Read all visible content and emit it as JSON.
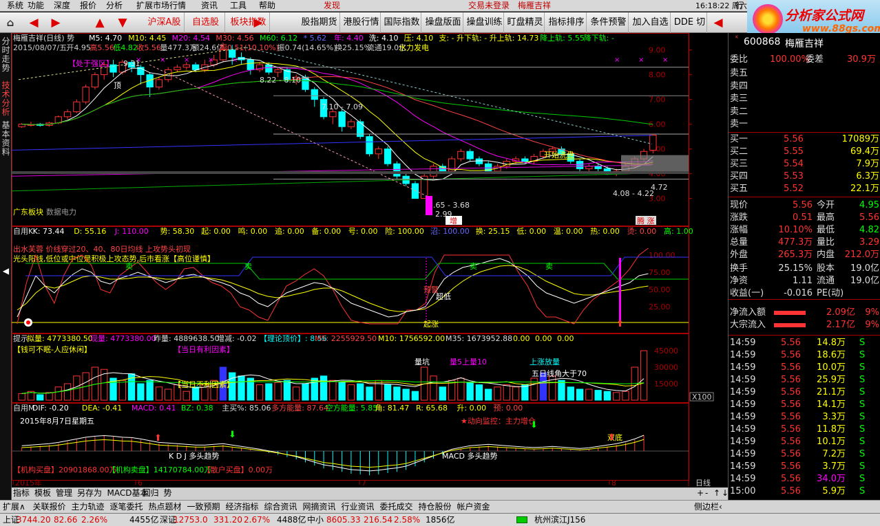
{
  "menu": {
    "items": [
      "系统",
      "功能",
      "深度",
      "报价",
      "分析",
      "扩展市场行情",
      "资讯",
      "工具",
      "帮助"
    ],
    "caption": "发现",
    "login": "交易未登录",
    "stock_title": "梅雁吉祥",
    "clock": "16:18:22 周六",
    "extra": "行"
  },
  "logo": {
    "name": "分析家公式网",
    "url": "www.88gs.com"
  },
  "toolbar": {
    "buttons": [
      "沪深A股",
      "自选股",
      "板块指数",
      "股指期货",
      "港股行情",
      "国际指数",
      "操盘版面",
      "操盘训练",
      "盯盘精灵",
      "指标排序",
      "条件预警",
      "加入自选",
      "DDE 切"
    ],
    "arrows": [
      "◀",
      "▶",
      "▲",
      "▼",
      "▶",
      "◀"
    ]
  },
  "leftbar": {
    "tabs": [
      "分时走势",
      "技术分析",
      "基本资料"
    ]
  },
  "main": {
    "title": "梅雁吉祥(日线) 势",
    "ma": [
      "M5: 4.70",
      "M10: 4.45",
      "M20: 4.54",
      "M30: 4.56",
      "M60: 6.12",
      "* 5.62",
      "年: 4.40",
      "洗: 4.10",
      "压: 4.10",
      "支: - 升下轨: - 升上轨: 14.73",
      "降上轨: 5.55",
      "降下轨: -"
    ],
    "info": [
      "2015/08/07/五",
      "开4.95",
      "高5.56",
      "低4.82",
      "收5.56",
      "量477.3万",
      "额24.6亿",
      "幅0.51(10.10%)",
      "振0.74(14.65%)",
      "换25.15%",
      "流通19.0亿",
      "水力发电"
    ],
    "labels": {
      "zone": "【处于强区】",
      "p931": "9.31",
      "hi_range": "8.22 - 8.10",
      "mid_range": "7.10 - 7.09",
      "lo_range": "3.65 - 3.68",
      "low": "2.99",
      "right_range": "4.08 - 4.22",
      "p472": "4.72",
      "wash": "开始洗盘",
      "dz": "顶",
      "zeng": "增",
      "zhang": "涨",
      "teng": "腾",
      "block": "广东板块",
      "block2": "数据电力"
    },
    "yticks": [
      "9.00",
      "8.00",
      "7.00",
      "6.00",
      "5.00",
      "4.00",
      "3.00"
    ]
  },
  "kdj": {
    "header": [
      "自用K",
      "K: 73.44",
      "D: 55.16",
      "J: 110.00",
      "势: 58.30",
      "起: 0.00",
      "鸣: 0.00",
      "追: 0.00",
      "备: 0.00",
      "号: 0.00",
      "险: 100.00",
      "沼: 100.00",
      "换: 25.15",
      "低: 0.00",
      "温: 0.00",
      "热: 0.00",
      "烫: 0.00",
      "高: 1.00"
    ],
    "note1": "出水芙蓉 价线穿过20、40、80日均线 上攻势头初现",
    "note2": "光头阳线,低位或中位是积极上攻态势,后市看涨【高位谨慎】",
    "labels": {
      "sell": "卖",
      "warn": "预警",
      "chaodi": "超低",
      "rise": "起涨"
    },
    "yticks": [
      "100.00",
      "75.00",
      "50.00",
      "25.00"
    ]
  },
  "vol": {
    "header": [
      "提示",
      "拟量: 4773380.50",
      "现量: 4773380.00",
      "昨量: 4889638.50",
      "增减: -0.02",
      "【理论顶价】: 8.56",
      "M5: 2255929.50",
      "M10: 1756592.00",
      "M35: 1673952.88",
      "0.00",
      "0.00",
      "0.00"
    ],
    "labels": {
      "a": "【钱可不眠-人应休闲】",
      "b": "【当日有利因素】",
      "c": "【当日不利因素】",
      "d": "量坑",
      "e": "量5上量10",
      "f": "上涨放量",
      "g": "五日线角大于70",
      "x100": "X100"
    },
    "yticks": [
      "45000",
      "30000",
      "15000"
    ]
  },
  "macd": {
    "header": [
      "自用M",
      "DIF: -0.20",
      "DEA: -0.41",
      "MACD: 0.41",
      "BZ: 0.38",
      "主买%: 85.06",
      "多方能量: 87.64",
      "空方能量: 5.85",
      "角: 81.47",
      "R: 65.68",
      "升: 0.00",
      "预: 0.00"
    ],
    "labels": {
      "date": "2015年8月7日星期五",
      "kdj": "K D J 多头趋势",
      "macdt": "MACD 多头趋势",
      "monitor": "★动向监控：主力增仓",
      "double": "双底"
    },
    "footer": [
      "【机构买盘】20901868.00万",
      "【机构卖盘】14170784.00万",
      "【散户买盘】0.00万"
    ]
  },
  "xaxis": {
    "labels": [
      "2015年",
      "6",
      "7",
      "8"
    ],
    "period": "日线"
  },
  "quote": {
    "code": "600868",
    "name": "梅雁吉祥",
    "weibi": "100.00%",
    "weicha": "30.9万",
    "sell": [
      [
        "卖五",
        ""
      ],
      [
        "卖四",
        ""
      ],
      [
        "卖三",
        ""
      ],
      [
        "卖二",
        ""
      ],
      [
        "卖一",
        ""
      ]
    ],
    "buy": [
      [
        "买一",
        "5.56",
        "17089万"
      ],
      [
        "买二",
        "5.55",
        "69.4万"
      ],
      [
        "买三",
        "5.54",
        "7.9万"
      ],
      [
        "买四",
        "5.53",
        "6.3万"
      ],
      [
        "买五",
        "5.52",
        "22.1万"
      ]
    ],
    "stats": [
      [
        "现价",
        "5.56",
        "今开",
        "4.95"
      ],
      [
        "涨跌",
        "0.51",
        "最高",
        "5.56"
      ],
      [
        "涨幅",
        "10.10%",
        "最低",
        "4.82"
      ],
      [
        "总量",
        "477.3万",
        "量比",
        "3.29"
      ],
      [
        "外盘",
        "265.3万",
        "内盘",
        "212.0万"
      ],
      [
        "换手",
        "25.15%",
        "股本",
        "19.0亿"
      ],
      [
        "净资",
        "1.11",
        "流通",
        "19.0亿"
      ],
      [
        "收益(一)",
        "-0.016",
        "PE(动)",
        ""
      ]
    ],
    "flow": [
      [
        "净流入额",
        "2.09亿",
        "9%"
      ],
      [
        "大宗流入",
        "2.17亿",
        "9%"
      ]
    ],
    "ticks": [
      [
        "14:59",
        "5.56",
        "14.8万",
        "S"
      ],
      [
        "14:59",
        "5.56",
        "18.6万",
        "S"
      ],
      [
        "14:59",
        "5.56",
        "10.0万",
        "S"
      ],
      [
        "14:59",
        "5.56",
        "25.9万",
        "S"
      ],
      [
        "14:59",
        "5.56",
        "21.1万",
        "S"
      ],
      [
        "14:59",
        "5.56",
        "14.1万",
        "S"
      ],
      [
        "14:59",
        "5.56",
        "3.3万",
        "S"
      ],
      [
        "14:59",
        "5.56",
        "11.8万",
        "S"
      ],
      [
        "14:59",
        "5.56",
        "10.1万",
        "S"
      ],
      [
        "14:59",
        "5.56",
        "7.2万",
        "S"
      ],
      [
        "14:59",
        "5.56",
        "3.7万",
        "S"
      ],
      [
        "14:59",
        "5.56",
        "34.0万",
        "S"
      ],
      [
        "15:00",
        "5.56",
        "5.9万",
        "S"
      ]
    ],
    "tabs": [
      "笔",
      "价",
      "细",
      "日",
      "势",
      "联",
      "值"
    ]
  },
  "tabs1": [
    "指标",
    "模板",
    "管理",
    "另存为",
    "MACD基本",
    "回归",
    "势"
  ],
  "tabs2": [
    "扩展∧",
    "关联报价",
    "主力轨迹",
    "逐笔委托",
    "热点题材",
    "一致预期",
    "经济指标",
    "综合资讯",
    "网摘资讯",
    "行业资讯",
    "委托成交",
    "持仓股份",
    "帐户资金"
  ],
  "tabs2_right": "侧边栏‹",
  "status": {
    "sh": "上证",
    "sh_val": "3744.20",
    "sh_chg": "82.66",
    "sh_pct": "2.26%",
    "sh_amt": "4455亿",
    "sz": "深证",
    "sz_val": "12753.0",
    "sz_chg": "331.20",
    "sz_pct": "2.67%",
    "sz_amt": "4488亿",
    "zx": "中小",
    "zx_val": "8605.33",
    "zx_chg": "216.54",
    "zx_pct": "2.58%",
    "zx_amt": "1856亿",
    "server": "杭州滨江J156"
  }
}
